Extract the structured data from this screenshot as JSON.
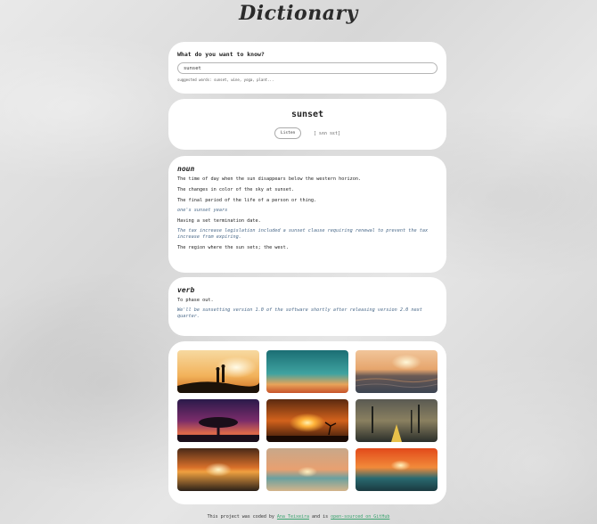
{
  "app": {
    "title": "Dictionary"
  },
  "search": {
    "question": "What do you want to know?",
    "value": "sunset",
    "hint": "suggested words: sunset, wine, yoga, plant..."
  },
  "word": {
    "text": "sunset",
    "listen_label": "Listen",
    "phonetic": "[ sʌn sɛt]"
  },
  "meanings": [
    {
      "part_of_speech": "noun",
      "definitions": [
        {
          "definition": "The time of day when the sun disappears below the western horizon."
        },
        {
          "definition": "The changes in color of the sky at sunset."
        },
        {
          "definition": "The final period of the life of a person or thing.",
          "example": "one's sunset years"
        },
        {
          "definition": "Having a set termination date.",
          "example": "The tax increase legislation included a sunset clause requiring renewal to prevent the tax increase from expiring."
        },
        {
          "definition": "The region where the sun sets; the west."
        }
      ]
    },
    {
      "part_of_speech": "verb",
      "definitions": [
        {
          "definition": "To phase out.",
          "example": "We'll be sunsetting version 1.0 of the software shortly after releasing version 2.0 next quarter."
        }
      ]
    }
  ],
  "photos": [
    {
      "name": "couple-silhouette-sunset-photo"
    },
    {
      "name": "teal-orange-sky-photo"
    },
    {
      "name": "ocean-waves-sunset-photo"
    },
    {
      "name": "purple-tree-sunset-photo"
    },
    {
      "name": "orange-sun-tree-photo"
    },
    {
      "name": "palm-road-sunset-photo"
    },
    {
      "name": "sea-horizon-sunset-photo"
    },
    {
      "name": "hazy-beach-sunset-photo"
    },
    {
      "name": "red-sea-sunset-photo"
    }
  ],
  "footer": {
    "prefix": "This project was coded by",
    "author": "Ana Teixeira",
    "middle": "and is",
    "link": "open-sourced on GitHub"
  }
}
